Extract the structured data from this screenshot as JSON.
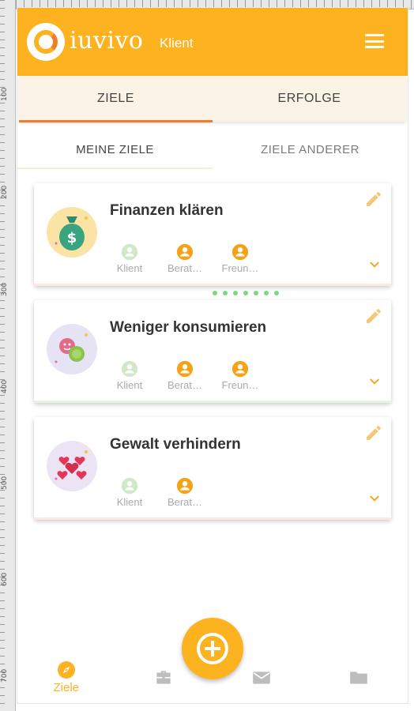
{
  "rulers": {
    "left_numbers": [
      "100",
      "200",
      "300",
      "400",
      "500",
      "600",
      "700"
    ]
  },
  "header": {
    "brand": "iuvivo",
    "role": "Klient",
    "accent_color": "#fdb220"
  },
  "main_tabs": [
    {
      "label": "ZIELE",
      "active": true
    },
    {
      "label": "ERFOLGE",
      "active": false
    }
  ],
  "sub_tabs": [
    {
      "label": "MEINE ZIELE",
      "active": true
    },
    {
      "label": "ZIELE ANDERER",
      "active": false
    }
  ],
  "goals": [
    {
      "title": "Finanzen klären",
      "icon": "money-bag-icon",
      "participants": [
        {
          "label": "Klient",
          "status": "inactive"
        },
        {
          "label": "Berat…",
          "status": "active"
        },
        {
          "label": "Freun…",
          "status": "active"
        }
      ]
    },
    {
      "title": "Weniger konsumieren",
      "icon": "coins-icon",
      "participants": [
        {
          "label": "Klient",
          "status": "inactive"
        },
        {
          "label": "Berat…",
          "status": "active"
        },
        {
          "label": "Freun…",
          "status": "active"
        }
      ]
    },
    {
      "title": "Gewalt verhindern",
      "icon": "hearts-icon",
      "participants": [
        {
          "label": "Klient",
          "status": "inactive"
        },
        {
          "label": "Berat…",
          "status": "active"
        }
      ]
    }
  ],
  "bottom_nav": [
    {
      "label": "Ziele",
      "icon": "compass-icon",
      "active": true
    },
    {
      "label": "",
      "icon": "briefcase-icon",
      "active": false
    },
    {
      "label": "",
      "icon": "mail-icon",
      "active": false
    },
    {
      "label": "",
      "icon": "folder-icon",
      "active": false
    }
  ],
  "fab": {
    "icon": "add-circle-icon"
  }
}
